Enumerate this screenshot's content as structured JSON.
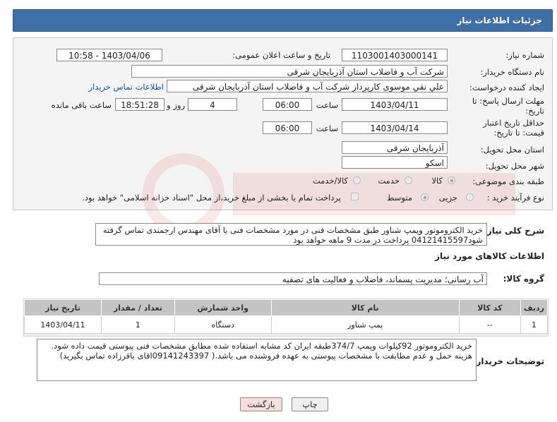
{
  "header": {
    "title": "جزئیات اطلاعات نیاز"
  },
  "form": {
    "need_number_label": "شماره نیاز:",
    "need_number": "1103001403000141",
    "announce_label": "تاریخ و ساعت اعلان عمومی:",
    "announce_value": "1403/04/06 - 10:58",
    "buyer_org_label": "نام دستگاه خریدار:",
    "buyer_org": "شرکت آب و فاضلاب استان آذربایجان شرقی",
    "requester_label": "ایجاد کننده درخواست:",
    "requester": "علي نقي موسوی کارپرداز شرکت آب و فاضلاب استان آذربایجان شرقی",
    "contact_link": "اطلاعات تماس خریدار",
    "reply_deadline_label": "مهلت ارسال پاسخ: تا تاریخ:",
    "reply_date": "1403/04/11",
    "time_label": "ساعت",
    "reply_time": "06:00",
    "days_value": "4",
    "days_label": "روز و",
    "remaining_time": "18:51:28",
    "remaining_label": "ساعت باقی مانده",
    "validity_label": "حداقل تاریخ اعتبار قیمت: تا تاریخ:",
    "validity_date": "1403/04/14",
    "validity_time": "06:00",
    "province_label": "استان محل تحویل:",
    "province": "آذربایجان شرقی",
    "city_label": "شهر محل تحویل:",
    "city": "اسکو",
    "category_label": "طبقه بندی موضوعی:",
    "category_options": [
      "کالا",
      "خدمت",
      "کالا/خدمت"
    ],
    "process_label": "نوع فرآیند خرید :",
    "process_options": [
      "جزیی",
      "متوسط"
    ],
    "payment_note": "پرداخت تمام یا بخشی از مبلغ خرید،از محل \"اسناد خزانه اسلامی\" خواهد بود."
  },
  "general_desc": {
    "label": "شرح کلی نیاز:",
    "text": "خرید الکتروموتور وپمپ شناور طبق مشخصات فنی در مورد مشخصات فنی با آقای مهندس ارجمندی تماس گرفته شود04121415597   پرداخت  در مدت 9 ماهه خواهد بود"
  },
  "goods_info": {
    "title": "اطلاعات کالاهای مورد نیاز",
    "group_label": "گروه کالا:",
    "group_value": "آب رسانی؛ مدیریت پسماند، فاضلاب و فعالیت های تصفیه"
  },
  "items_table": {
    "headers": [
      "ردیف",
      "کد کالا",
      "نام کالا",
      "واحد شمارش",
      "تعداد / مقدار",
      "تاریخ نیاز"
    ],
    "rows": [
      [
        "1",
        "--",
        "پمپ شناور",
        "دستگاه",
        "1",
        "1403/04/11"
      ]
    ]
  },
  "buyer_notes": {
    "label": "توضیحات خریدار:",
    "text": "خرید الکتروموتور 92کیلوات وپمپ 374/7طبقه    ایران کد مشابه استفاده شده مطابق مشخصات فنی پیوستی قیمت داده شود. هزینه حمل و عدم مطابقت با مشخصات پیوستی به عهده فروشنده می باشد.( 09141243397اقای باقرزاده تماس بگیرید)"
  },
  "buttons": {
    "print": "چاپ",
    "back": "بازگشت"
  },
  "colors": {
    "header_bg": "#3f6fa6",
    "table_header": "#c4c4c4",
    "back_button": "#f7dede"
  }
}
